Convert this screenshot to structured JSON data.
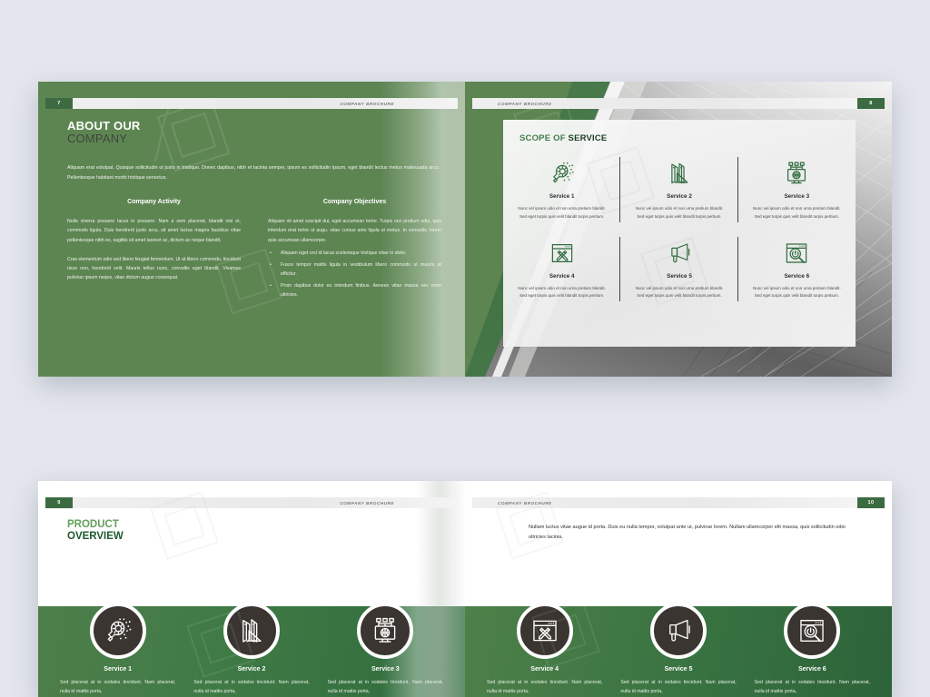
{
  "background_color": "#e3e6ec",
  "colors": {
    "brand_green": "#5d8552",
    "deep_green": "#2f6b3d",
    "badge_green": "#3c6b42",
    "dark_circle": "#3a3530",
    "title_dark": "#3f463d"
  },
  "brand_label": "COMPANY BROCHURE",
  "pages": {
    "page7": {
      "number": "7",
      "brand": "COMPANY BROCHURE",
      "title_line1": "ABOUT OUR",
      "title_line2": "COMPANY",
      "intro": "Aliquam erat volutpat. Quisque sollicitudin ut justo in tristique. Donec dapibus, nibh et lacinia semper, ipsum ex sollicitudin ipsum, eget blandit lectus metus malesuada arcu. Pellentesque habitant morbi tristique senectus.",
      "col_left": {
        "heading": "Company Activity",
        "paragraphs": [
          "Nulla viverra posuere lacus in posuere. Nam a sem placerat, blandit nisi et, commodo ligula. Duis hendrerit justo arcu, sit amet luctus magna faucibus vitae pellentesque nibh ex, sagittis sit amet laoreet ac, dictum ac neque blandit.",
          "Cras elementum odio sed libero feugiat fermentum. Ut at libero commodo, tincidunt risus non, hendrerit velit. Mauris tellus nunc, convallis eget blandit. Vivamus pulvinar ipsum neque, vitae dictum augue consequat."
        ]
      },
      "col_right": {
        "heading": "Company Objectives",
        "paragraphs": [
          "Aliquam sit amet suscipit dui, eget accumsan tortor. Turpis orci pretium odio, quis interdum erat tortor ut augu. vitae cursus ante ligula ut metus. In convallis, lorem quis accumsan ullamcorper."
        ],
        "bullets": [
          "Aliquam eget orci id lacus scelerisque tristique vitae in dolor.",
          "Fusce tempor mattis ligula in vestibulum libero commodo ut mauris at efficitur.",
          "Proin dapibus dolor eu interdum finibus. Aenean vitae massa nec enim ultricies."
        ]
      }
    },
    "page8": {
      "number": "8",
      "brand": "COMPANY BROCHURE",
      "title_line1": "SCOPE OF ",
      "title_line2": "SERVICE",
      "services": [
        {
          "icon": "lightbulb-gear-icon",
          "name": "Service 1",
          "desc": "Nunc vel ipsum odio et non urna pretium blandit. Sed eget turpis quis velit blandit turpis pertium."
        },
        {
          "icon": "pencils-ruler-icon",
          "name": "Service 2",
          "desc": "Nunc vel ipsum odio et non urna pretium blandit. Sed eget turpis quis velit blandit turpis pertium."
        },
        {
          "icon": "monitor-network-icon",
          "name": "Service 3",
          "desc": "Nunc vel ipsum odio et non urna pretium blandit. Sed eget turpis quis velit blandit turpis pertium."
        },
        {
          "icon": "browser-design-tools-icon",
          "name": "Service 4",
          "desc": "Nunc vel ipsum odio et non urna pretium blandit. Sed eget turpis quis velit blandit turpis pertium."
        },
        {
          "icon": "megaphone-icon",
          "name": "Service 5",
          "desc": "Nunc vel ipsum odio et non urna pretium blandit. Sed eget turpis quis velit blandit turpis pertium."
        },
        {
          "icon": "magnifier-power-icon",
          "name": "Service 6",
          "desc": "Nunc vel ipsum odio et non urna pretium blandit. Sed eget turpis quis velit blandit turpis pertium."
        }
      ]
    },
    "page9": {
      "number": "9",
      "brand": "COMPANY BROCHURE",
      "title_line1": "PRODUCT",
      "title_line2": "OVERVIEW",
      "items": [
        {
          "icon": "lightbulb-gear-icon",
          "name": "Service 1",
          "desc": "Sed placerat at in sodales tincidunt. Nam placerat, nulla id mattis porta,"
        },
        {
          "icon": "pencils-ruler-icon",
          "name": "Service 2",
          "desc": "Sed placerat at in sodales tincidunt. Nam placerat, nulla id mattis porta,"
        },
        {
          "icon": "monitor-network-icon",
          "name": "Service 3",
          "desc": "Sed placerat at in sodales tincidunt. Nam placerat, nulla id mattis porta,"
        }
      ]
    },
    "page10": {
      "number": "10",
      "brand": "COMPANY BROCHURE",
      "intro": "Nullam luctus vitae augue id porta. Duis eu nulla tempor, volutpat ante ut, pulvinar lorem. Nullam ullamcorper elit massa, quis sollicitudin odio ultricies lacinia.",
      "items": [
        {
          "icon": "browser-design-tools-icon",
          "name": "Service 4",
          "desc": "Sed placerat at in sodales tincidunt. Nam placerat, nulla id mattis porta,"
        },
        {
          "icon": "megaphone-icon",
          "name": "Service 5",
          "desc": "Sed placerat at in sodales tincidunt. Nam placerat, nulla id mattis porta,"
        },
        {
          "icon": "magnifier-power-icon",
          "name": "Service 6",
          "desc": "Sed placerat at in sodales tincidunt. Nam placerat, nulla id mattis porta,"
        }
      ]
    }
  }
}
